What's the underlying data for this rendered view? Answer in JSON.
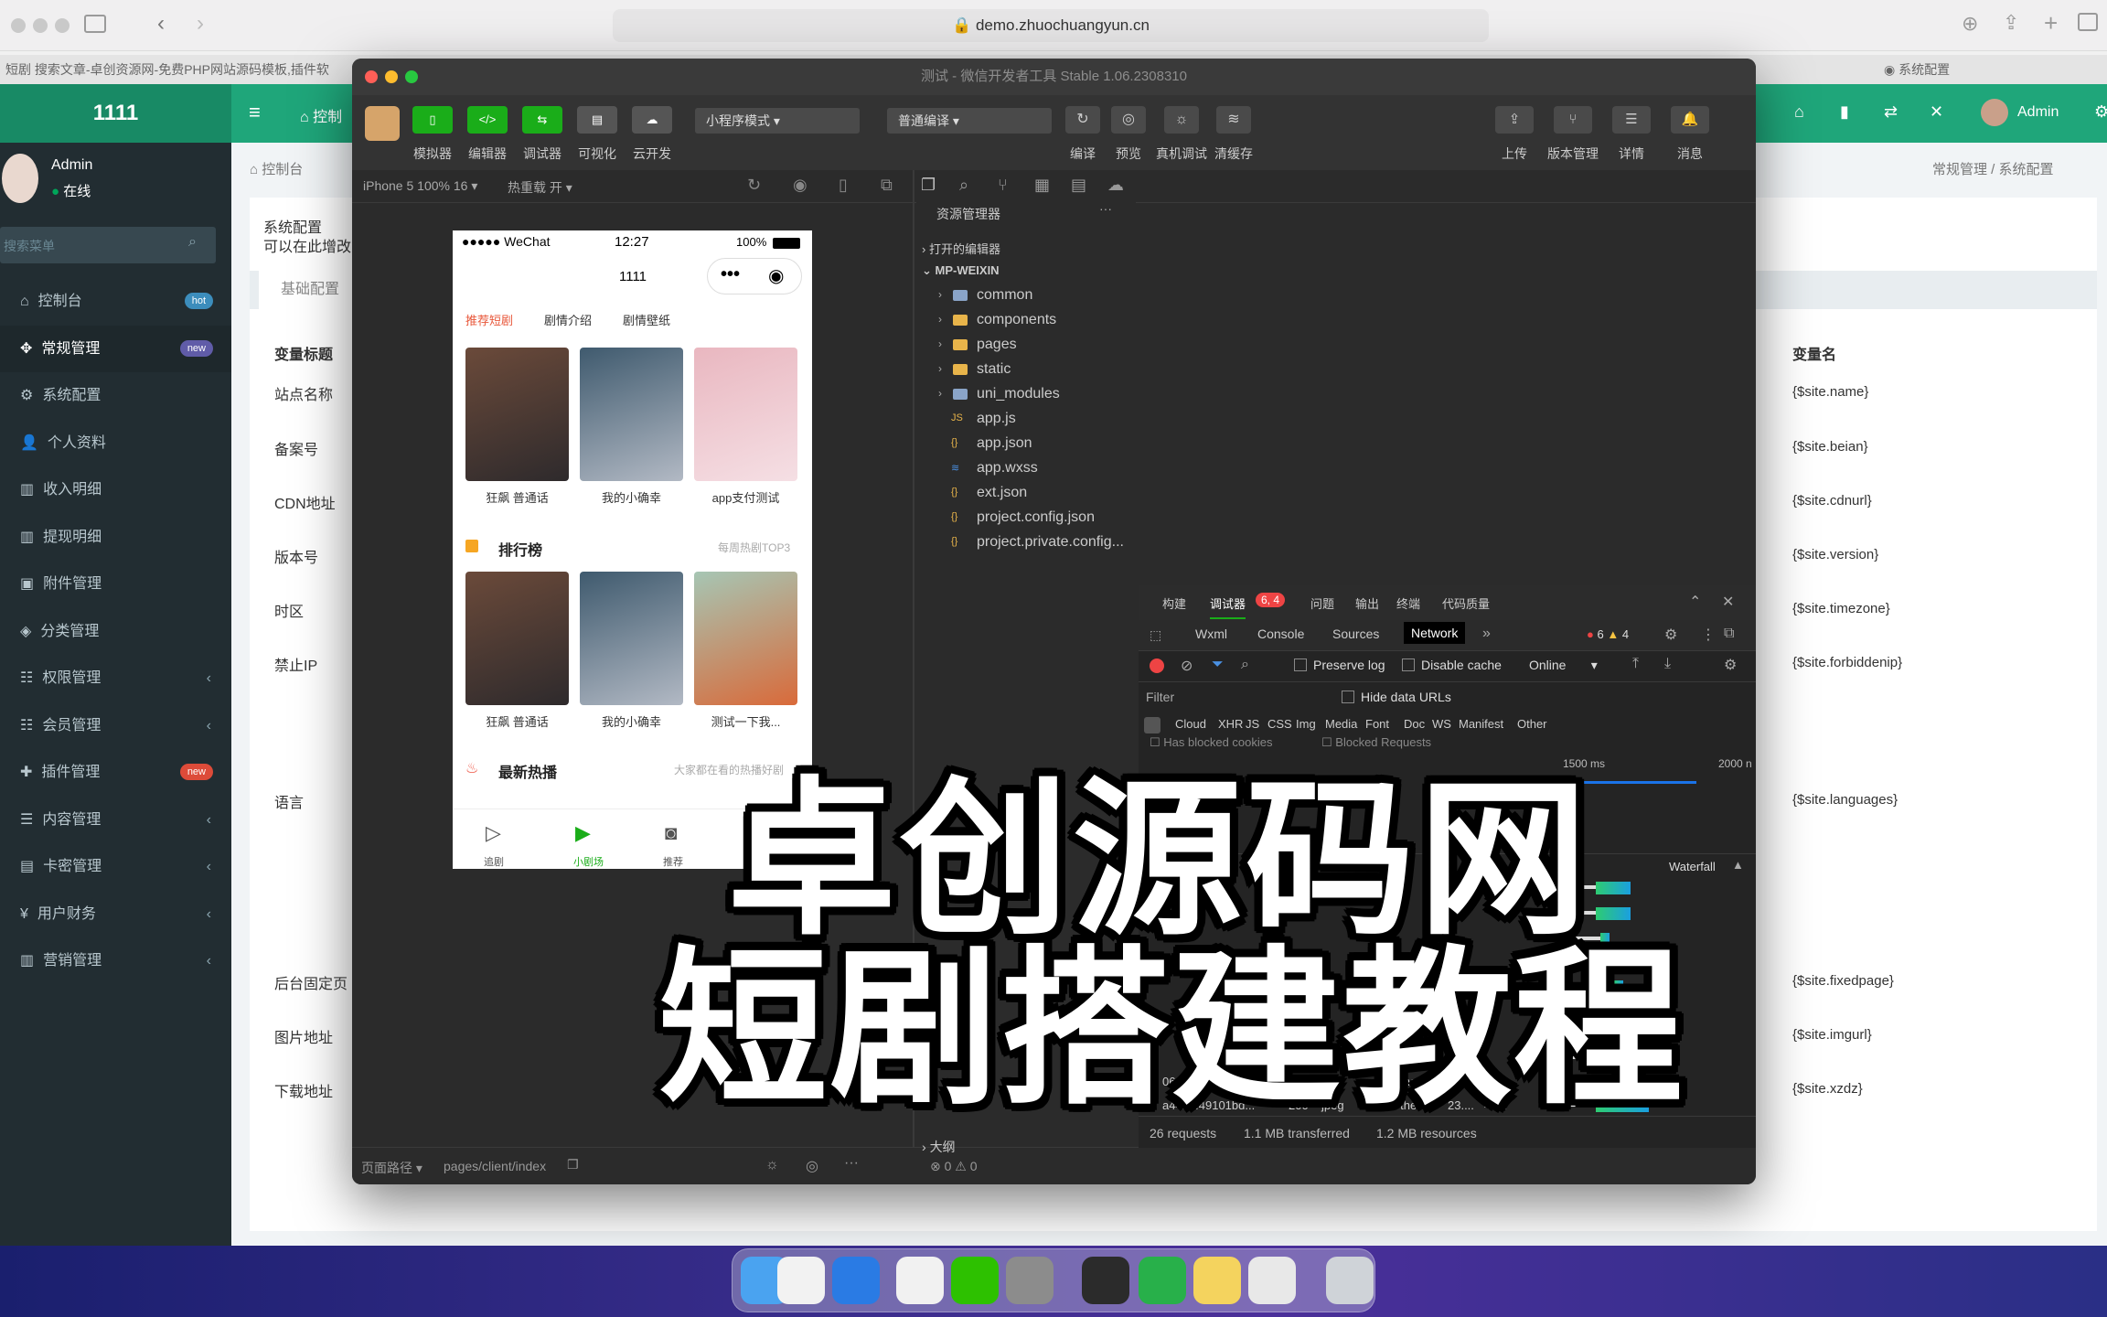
{
  "browser": {
    "url": "demo.zhuochuangyun.cn",
    "tab_text": "短剧 搜索文章-卓创资源网-免费PHP网站源码模板,插件软",
    "tab_right": "系统配置"
  },
  "admin": {
    "logo": "1111",
    "user_name": "Admin",
    "user_status": "在线",
    "search_placeholder": "搜索菜单",
    "top_tab": "控制",
    "top_user": "Admin",
    "breadcrumb_section": "控制台",
    "breadcrumb_right": "常规管理 / 系统配置",
    "panel_title": "系统配置",
    "panel_subtitle": "可以在此增改",
    "panel_tab": "基础配置",
    "col_title": "变量标题",
    "col_name": "变量名",
    "menu": [
      {
        "label": "控制台",
        "badge": "hot",
        "badge_color": "#3c8dbc"
      },
      {
        "label": "常规管理",
        "badge": "new",
        "badge_color": "#605ca8"
      },
      {
        "label": "系统配置"
      },
      {
        "label": "个人资料"
      },
      {
        "label": "收入明细"
      },
      {
        "label": "提现明细"
      },
      {
        "label": "附件管理"
      },
      {
        "label": "分类管理"
      },
      {
        "label": "权限管理",
        "arrow": "‹"
      },
      {
        "label": "会员管理",
        "arrow": "‹"
      },
      {
        "label": "插件管理",
        "badge": "new",
        "badge_color": "#dd4b39"
      },
      {
        "label": "内容管理",
        "arrow": "‹"
      },
      {
        "label": "卡密管理",
        "arrow": "‹"
      },
      {
        "label": "用户财务",
        "arrow": "‹"
      },
      {
        "label": "营销管理",
        "arrow": "‹"
      }
    ],
    "rows": [
      {
        "title": "站点名称",
        "name": "{$site.name}"
      },
      {
        "title": "备案号",
        "name": "{$site.beian}"
      },
      {
        "title": "CDN地址",
        "name": "{$site.cdnurl}"
      },
      {
        "title": "版本号",
        "name": "{$site.version}"
      },
      {
        "title": "时区",
        "name": "{$site.timezone}"
      },
      {
        "title": "禁止IP",
        "name": "{$site.forbiddenip}"
      },
      {
        "title": "语言",
        "name": "{$site.languages}"
      },
      {
        "title": "后台固定页",
        "name": "{$site.fixedpage}"
      },
      {
        "title": "图片地址",
        "name": "{$site.imgurl}"
      },
      {
        "title": "下载地址",
        "name": "{$site.xzdz}"
      }
    ]
  },
  "devtools": {
    "title": "测试 - 微信开发者工具 Stable 1.06.2308310",
    "tools": [
      "模拟器",
      "编辑器",
      "调试器",
      "可视化",
      "云开发"
    ],
    "mode": "小程序模式",
    "compile": "普通编译",
    "actions": [
      "编译",
      "预览",
      "真机调试",
      "清缓存"
    ],
    "right_actions": [
      "上传",
      "版本管理",
      "详情",
      "消息"
    ],
    "device": "iPhone 5 100% 16 ▾",
    "hot_reload": "热重载 开 ▾",
    "footer_path_label": "页面路径 ▾",
    "footer_path": "pages/client/index",
    "footer_errors": "⊗ 0 ⚠ 0"
  },
  "phone": {
    "carrier": "●●●●● WeChat",
    "time": "12:27",
    "battery": "100%",
    "title": "1111",
    "tabs": [
      "推荐短剧",
      "剧情介绍",
      "剧情壁纸"
    ],
    "row1": [
      "狂飙 普通话",
      "我的小确幸",
      "app支付测试"
    ],
    "rank_title": "排行榜",
    "rank_more": "每周热剧TOP3",
    "row2": [
      "狂飙 普通话",
      "我的小确幸",
      "测试一下我..."
    ],
    "hot_title": "最新热播",
    "hot_more": "大家都在看的热播好剧",
    "nav": [
      "追剧",
      "小剧场",
      "推荐"
    ]
  },
  "explorer": {
    "title": "资源管理器",
    "open_editors": "打开的编辑器",
    "project": "MP-WEIXIN",
    "folders": [
      "common",
      "components",
      "pages",
      "static",
      "uni_modules"
    ],
    "files": [
      "app.js",
      "app.json",
      "app.wxss",
      "ext.json",
      "project.config.json",
      "project.private.config..."
    ],
    "outline": "大纲"
  },
  "network": {
    "panel_tabs": [
      "构建",
      "调试器",
      "问题",
      "输出",
      "终端",
      "代码质量"
    ],
    "error_badge": "6, 4",
    "tabs": [
      "Wxml",
      "Console",
      "Sources",
      "Network"
    ],
    "errors": "6",
    "warnings": "4",
    "preserve_log": "Preserve log",
    "disable_cache": "Disable cache",
    "online": "Online",
    "filter": "Filter",
    "hide_data_urls": "Hide data URLs",
    "types": [
      "Cloud",
      "XHR",
      "JS",
      "CSS",
      "Img",
      "Media",
      "Font",
      "Doc",
      "WS",
      "Manifest",
      "Other"
    ],
    "has_blocked": "Has blocked cookies",
    "blocked_requests": "Blocked Requests",
    "t1500": "1500 ms",
    "t2000": "2000 n",
    "waterfall": "Waterfall",
    "rows": [
      {
        "name": "06e3ca38cf5dc...",
        "status": "200",
        "type": "png",
        "initiator": "Other",
        "size": "36....",
        "time": "48..."
      },
      {
        "name": "a44b6f49101bd...",
        "status": "200",
        "type": "jpeg",
        "initiator": "Other",
        "size": "23....",
        "time": "48..."
      }
    ],
    "summary_requests": "26 requests",
    "summary_transferred": "1.1 MB transferred",
    "summary_resources": "1.2 MB resources"
  },
  "overlay": {
    "line1": "卓创源码网",
    "line2": "短剧搭建教程"
  },
  "dock": {
    "icons": [
      "finder-icon",
      "launchpad-icon",
      "safari-icon",
      "chrome-icon",
      "wechat-icon",
      "settings-icon",
      "video-icon",
      "hbuilder-icon",
      "notes-icon",
      "miniprogram-icon",
      "trash-icon"
    ]
  }
}
